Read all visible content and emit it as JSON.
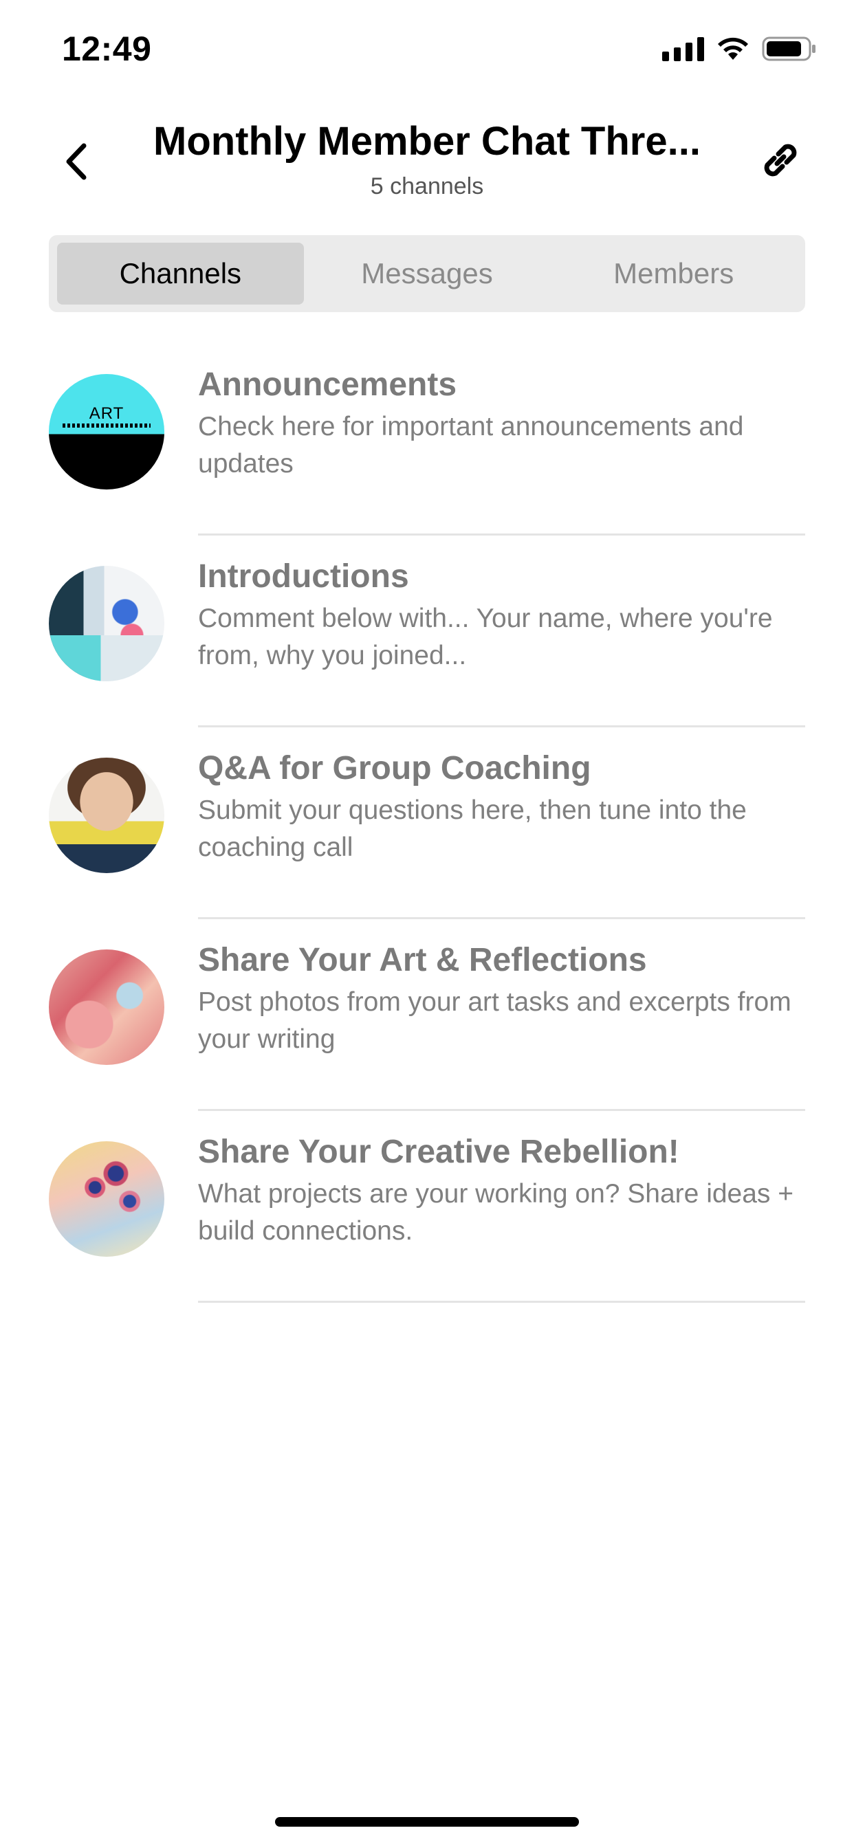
{
  "status_bar": {
    "time": "12:49"
  },
  "header": {
    "title": "Monthly Member Chat Thre...",
    "subtitle": "5 channels",
    "back_icon": "chevron-left-icon",
    "link_icon": "link-icon"
  },
  "tabs": [
    {
      "label": "Channels",
      "active": true
    },
    {
      "label": "Messages",
      "active": false
    },
    {
      "label": "Members",
      "active": false
    }
  ],
  "channels": [
    {
      "title": "Announcements",
      "description": "Check here for important announcements and updates",
      "avatar_text": "ART"
    },
    {
      "title": "Introductions",
      "description": "Comment below with... Your name, where you're from, why you joined..."
    },
    {
      "title": "Q&A for Group Coaching",
      "description": "Submit your questions here, then tune into the coaching call"
    },
    {
      "title": "Share Your Art & Reflections",
      "description": "Post photos from your art tasks and excerpts from your writing"
    },
    {
      "title": "Share Your Creative Rebellion!",
      "description": "What projects are your working on? Share ideas + build connections."
    }
  ],
  "colors": {
    "tab_bar_bg": "#ebebeb",
    "tab_active_bg": "#d2d2d2",
    "channel_text": "#7a7a7a",
    "divider": "#e4e4e4"
  }
}
